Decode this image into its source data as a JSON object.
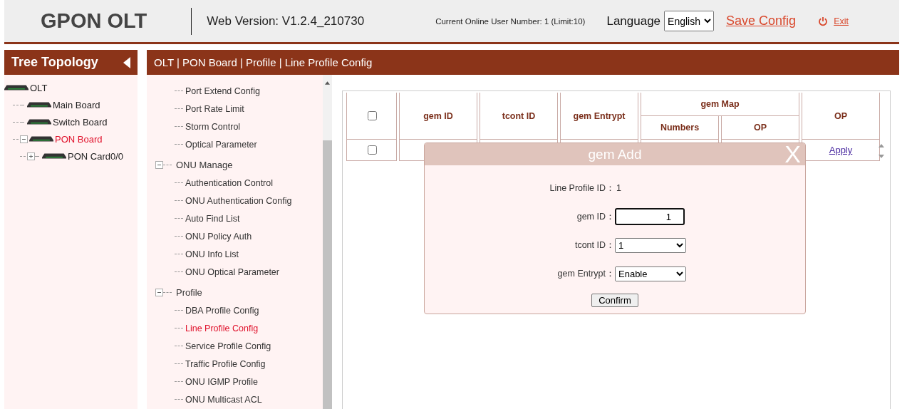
{
  "header": {
    "logo": "GPON OLT",
    "version": "Web Version: V1.2.4_210730",
    "online_users": "Current Online User Number: 1 (Limit:10)",
    "language_label": "Language",
    "language_value": "English",
    "save_config": "Save Config",
    "exit": "Exit"
  },
  "tree": {
    "title": "Tree Topology",
    "items": [
      {
        "label": "OLT",
        "selected": false,
        "children": [
          {
            "label": "Main Board",
            "selected": false
          },
          {
            "label": "Switch Board",
            "selected": false
          },
          {
            "label": "PON Board",
            "selected": true,
            "expanded": true,
            "children": [
              {
                "label": "PON Card0/0",
                "selected": false,
                "expanded": false
              }
            ]
          }
        ]
      }
    ]
  },
  "breadcrumb": "OLT | PON Board | Profile | Line Profile Config",
  "menu": {
    "sections": [
      {
        "items": [
          {
            "label": "Port Extend Config",
            "selected": false
          },
          {
            "label": "Port Rate Limit",
            "selected": false
          },
          {
            "label": "Storm Control",
            "selected": false
          },
          {
            "label": "Optical Parameter",
            "selected": false
          }
        ]
      },
      {
        "title": "ONU Manage",
        "expanded": true,
        "items": [
          {
            "label": "Authentication Control",
            "selected": false
          },
          {
            "label": "ONU Authentication Config",
            "selected": false
          },
          {
            "label": "Auto Find List",
            "selected": false
          },
          {
            "label": "ONU Policy Auth",
            "selected": false
          },
          {
            "label": "ONU Info List",
            "selected": false
          },
          {
            "label": "ONU Optical Parameter",
            "selected": false
          }
        ]
      },
      {
        "title": "Profile",
        "expanded": true,
        "items": [
          {
            "label": "DBA Profile Config",
            "selected": false
          },
          {
            "label": "Line Profile Config",
            "selected": true
          },
          {
            "label": "Service Profile Config",
            "selected": false
          },
          {
            "label": "Traffic Profile Config",
            "selected": false
          },
          {
            "label": "ONU IGMP Profile",
            "selected": false
          },
          {
            "label": "ONU Multicast ACL",
            "selected": false
          }
        ]
      }
    ]
  },
  "table": {
    "columns": {
      "gem_id": "gem ID",
      "tcont_id": "tcont ID",
      "gem_entrypt": "gem Entrypt",
      "gem_map": "gem Map",
      "numbers": "Numbers",
      "map_op": "OP",
      "op": "OP"
    },
    "header_checked": false,
    "rows": [
      {
        "checked": false,
        "op": "Apply"
      }
    ]
  },
  "dialog": {
    "title": "gem Add",
    "close": "X",
    "fields": [
      {
        "kind": "text",
        "label": "Line Profile ID：",
        "value": "1"
      },
      {
        "kind": "number",
        "label": "gem ID：",
        "value": "1"
      },
      {
        "kind": "select",
        "label": "tcont ID：",
        "value": "1"
      },
      {
        "kind": "select",
        "label": "gem Entrypt：",
        "value": "Enable"
      }
    ],
    "confirm": "Confirm"
  }
}
